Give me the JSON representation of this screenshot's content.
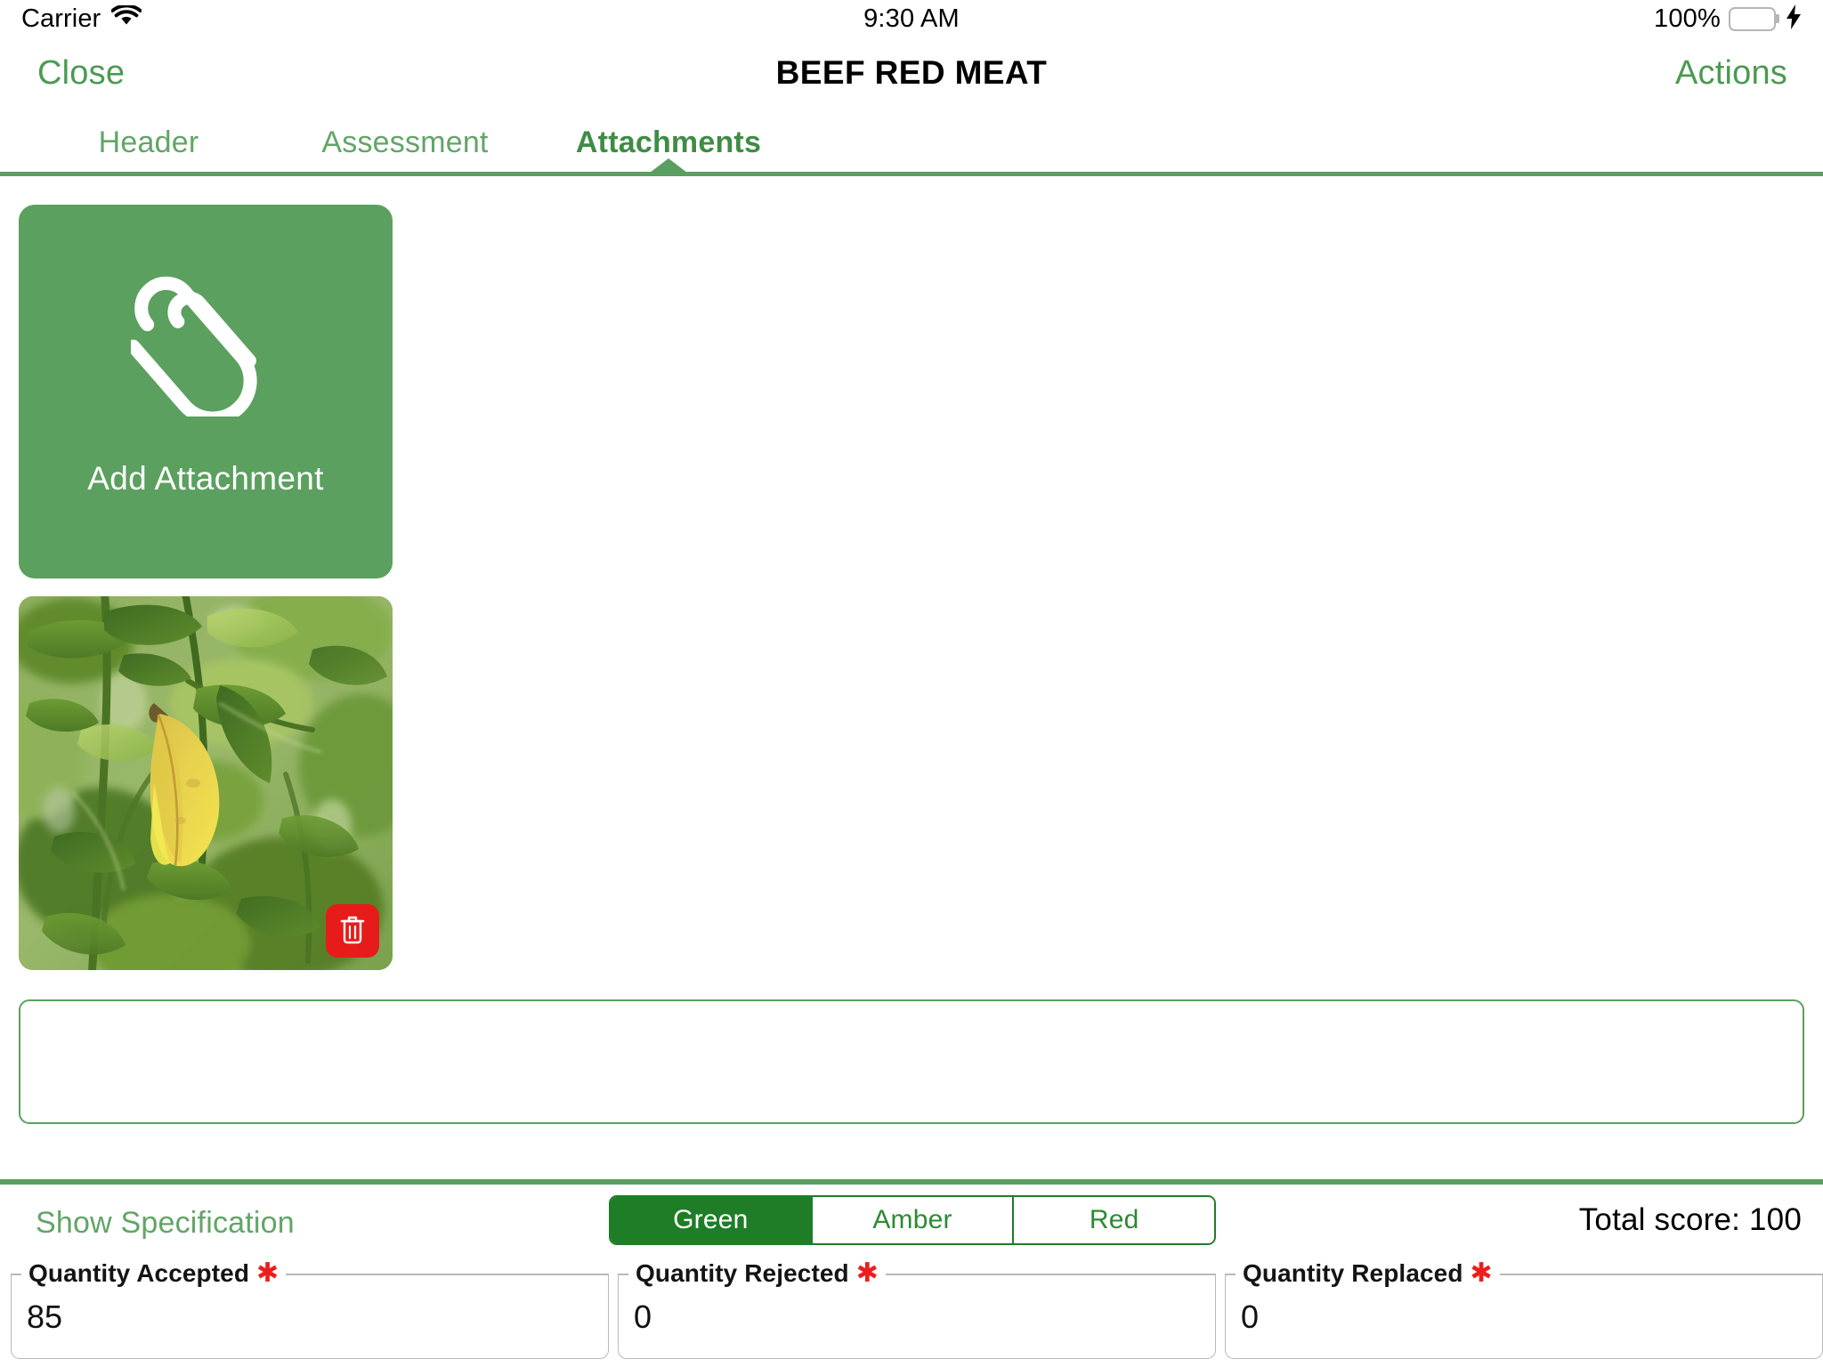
{
  "status_bar": {
    "carrier": "Carrier",
    "wifi_icon": "wifi-icon",
    "time": "9:30 AM",
    "battery_percent": "100%",
    "battery_icon": "battery-full-icon",
    "charging_icon": "lightning-bolt-icon"
  },
  "nav": {
    "close_label": "Close",
    "title": "BEEF RED MEAT",
    "actions_label": "Actions"
  },
  "tabs": [
    {
      "label": "Header",
      "active": false
    },
    {
      "label": "Assessment",
      "active": false
    },
    {
      "label": "Attachments",
      "active": true
    }
  ],
  "attachments": {
    "add_button_label": "Add Attachment",
    "add_button_icon": "paperclip-icon",
    "items": [
      {
        "alt": "Citrus tree foliage with one yellowing leaf",
        "delete_icon": "trash-icon"
      }
    ]
  },
  "notes": {
    "value": "",
    "placeholder": ""
  },
  "bottom_bar": {
    "show_specification_label": "Show Specification",
    "total_score_label": "Total score: 100",
    "rag": {
      "options": [
        {
          "label": "Green",
          "selected": true
        },
        {
          "label": "Amber",
          "selected": false
        },
        {
          "label": "Red",
          "selected": false
        }
      ]
    },
    "fields": [
      {
        "label": "Quantity Accepted",
        "required": "✱",
        "value": "85"
      },
      {
        "label": "Quantity Rejected",
        "required": "✱",
        "value": "0"
      },
      {
        "label": "Quantity Replaced",
        "required": "✱",
        "value": "0"
      }
    ]
  },
  "colors": {
    "brand_green": "#5ba05f",
    "brand_green_dark": "#1e7d26",
    "tab_green": "#62a566",
    "delete_red": "#e81b1b",
    "required_red": "#ee1d1d",
    "battery_green": "#4cd964"
  }
}
